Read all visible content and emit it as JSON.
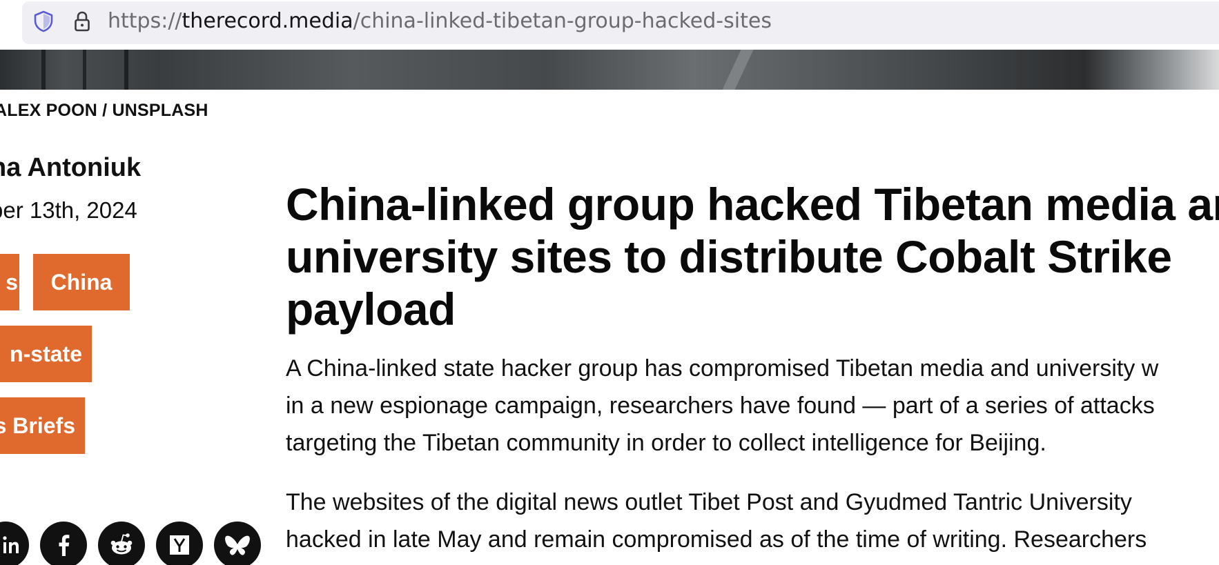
{
  "browser": {
    "url_scheme": "https://",
    "url_domain": "therecord.media",
    "url_path": "/china-linked-tibetan-group-hacked-sites",
    "icons": [
      "shield-icon",
      "lock-icon"
    ]
  },
  "article": {
    "photo_credit": "ALEX POON / UNSPLASH",
    "author": "na Antoniuk",
    "date": "ber 13th, 2024",
    "tags": [
      {
        "label": "s"
      },
      {
        "label": "China"
      },
      {
        "label": "n-state"
      },
      {
        "label": "s Briefs"
      }
    ],
    "share": [
      "linkedin-icon",
      "facebook-icon",
      "reddit-icon",
      "hacker-news-icon",
      "bluesky-icon"
    ],
    "headline_lines": [
      "China-linked group hacked Tibetan media an",
      "university sites to distribute Cobalt Strike",
      "payload"
    ],
    "paragraphs": [
      {
        "lines": [
          "A China-linked state hacker group has compromised Tibetan media and university w",
          "in a new espionage campaign, researchers have found — part of a series of attacks",
          "targeting the Tibetan community in order to collect intelligence for Beijing."
        ]
      },
      {
        "lines": [
          "The websites of the digital news outlet Tibet Post and Gyudmed Tantric University",
          "hacked in late May and remain compromised as of the time of writing. Researchers"
        ]
      }
    ]
  },
  "colors": {
    "tag_background": "#e06a2e",
    "tag_text": "#ffffff",
    "share_background": "#111111",
    "urlbar_background": "#f0f0f4"
  }
}
